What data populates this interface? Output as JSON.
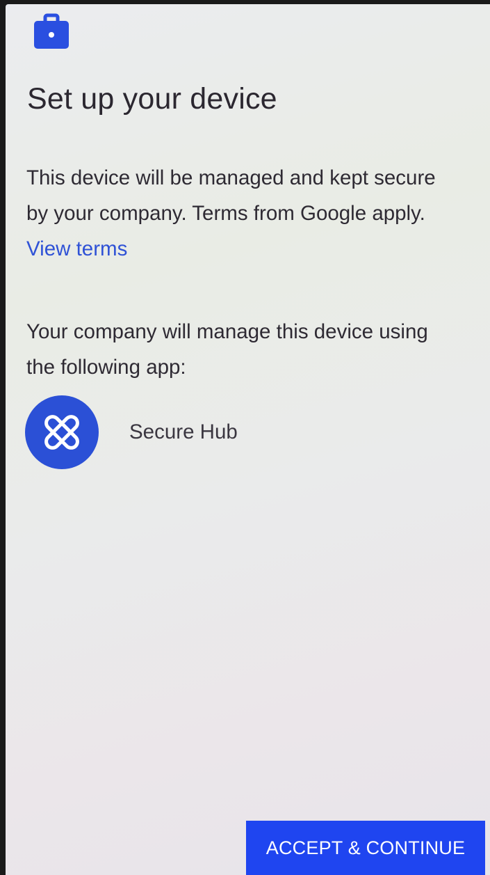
{
  "screen": {
    "title": "Set up your device",
    "intro": {
      "text": "This device will be managed and kept secure by your company. Terms from Google apply. ",
      "link_label": "View terms"
    },
    "managed_by_text": "Your company will manage this device using the following app:",
    "app": {
      "icon": "secure-hub-icon",
      "name": "Secure Hub"
    },
    "accept_button_label": "ACCEPT & CONTINUE"
  },
  "icons": {
    "header": "briefcase-icon"
  },
  "colors": {
    "accent": "#1f45f0",
    "link": "#2f52d6",
    "text": "#2e2a33"
  }
}
